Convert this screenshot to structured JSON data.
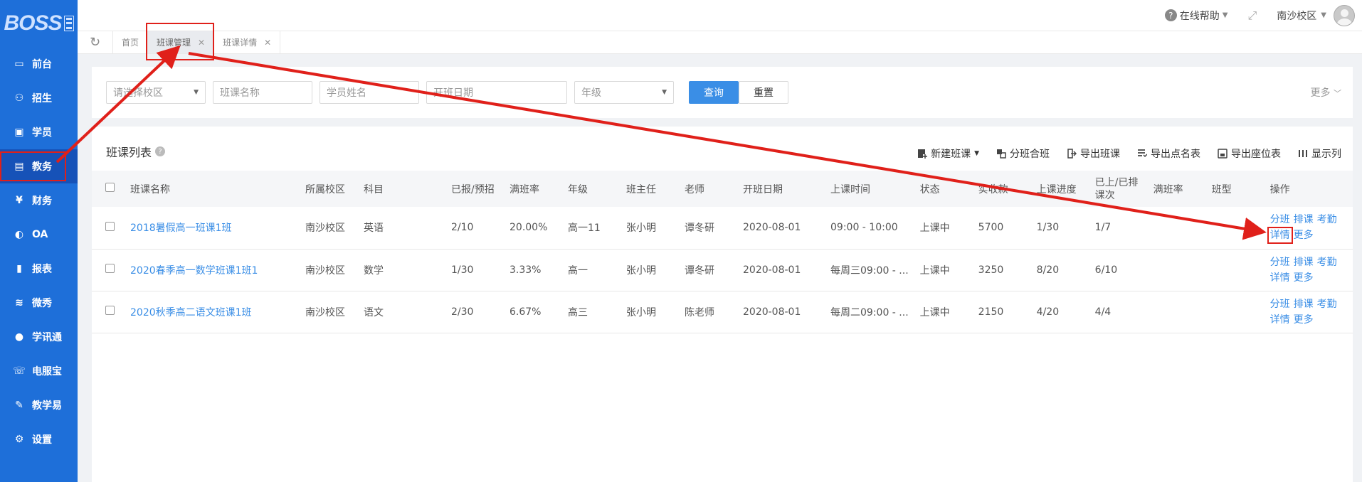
{
  "app": {
    "logo_text": "BOSS",
    "colors": {
      "sidebar": "#1e6fd9",
      "sidebar_active": "#1652b8",
      "primary": "#3a8ee6",
      "annotation": "#e0201a"
    }
  },
  "sidebar": {
    "items": [
      {
        "label": "前台",
        "icon": "window-icon"
      },
      {
        "label": "招生",
        "icon": "user-add-icon"
      },
      {
        "label": "学员",
        "icon": "user-card-icon"
      },
      {
        "label": "教务",
        "icon": "book-icon",
        "active": true
      },
      {
        "label": "财务",
        "icon": "yen-icon"
      },
      {
        "label": "OA",
        "icon": "toggle-icon"
      },
      {
        "label": "报表",
        "icon": "bar-chart-icon"
      },
      {
        "label": "微秀",
        "icon": "wave-icon"
      },
      {
        "label": "学讯通",
        "icon": "location-icon"
      },
      {
        "label": "电服宝",
        "icon": "phone-icon"
      },
      {
        "label": "教学易",
        "icon": "pen-icon"
      },
      {
        "label": "设置",
        "icon": "gear-icon"
      }
    ]
  },
  "header": {
    "help": "在线帮助",
    "campus": "南沙校区"
  },
  "tabs": [
    {
      "label": "首页",
      "closable": false
    },
    {
      "label": "班课管理",
      "closable": true,
      "active": true
    },
    {
      "label": "班课详情",
      "closable": true
    }
  ],
  "filter": {
    "campus_placeholder": "请选择校区",
    "class_name_placeholder": "班课名称",
    "student_placeholder": "学员姓名",
    "date_placeholder": "开班日期",
    "grade_placeholder": "年级",
    "query": "查询",
    "reset": "重置",
    "more": "更多"
  },
  "list": {
    "title": "班课列表",
    "actions": [
      "新建班课",
      "分班合班",
      "导出班课",
      "导出点名表",
      "导出座位表",
      "显示列"
    ],
    "columns": [
      "班课名称",
      "所属校区",
      "科目",
      "已报/预招",
      "满班率",
      "年级",
      "班主任",
      "老师",
      "开班日期",
      "上课时间",
      "状态",
      "实收款",
      "上课进度",
      "已上/已排课次",
      "满班率",
      "班型",
      "操作"
    ],
    "rows": [
      [
        "2018暑假高一班课1班",
        "南沙校区",
        "英语",
        "2/10",
        "20.00%",
        "高一11",
        "张小明",
        "谭冬研",
        "2020-08-01",
        "09:00 - 10:00",
        "上课中",
        "5700",
        "1/30",
        "1/7",
        "",
        ""
      ],
      [
        "2020春季高一数学班课1班1",
        "南沙校区",
        "数学",
        "1/30",
        "3.33%",
        "高一",
        "张小明",
        "谭冬研",
        "2020-08-01",
        "每周三09:00 - ...",
        "上课中",
        "3250",
        "8/20",
        "6/10",
        "",
        ""
      ],
      [
        "2020秋季高二语文班课1班",
        "南沙校区",
        "语文",
        "2/30",
        "6.67%",
        "高三",
        "张小明",
        "陈老师",
        "2020-08-01",
        "每周二09:00 - ...",
        "上课中",
        "2150",
        "4/20",
        "4/4",
        "",
        ""
      ]
    ],
    "ops_line1": [
      "分班",
      "排课",
      "考勤"
    ],
    "ops_line2": [
      "详情",
      "更多"
    ]
  }
}
